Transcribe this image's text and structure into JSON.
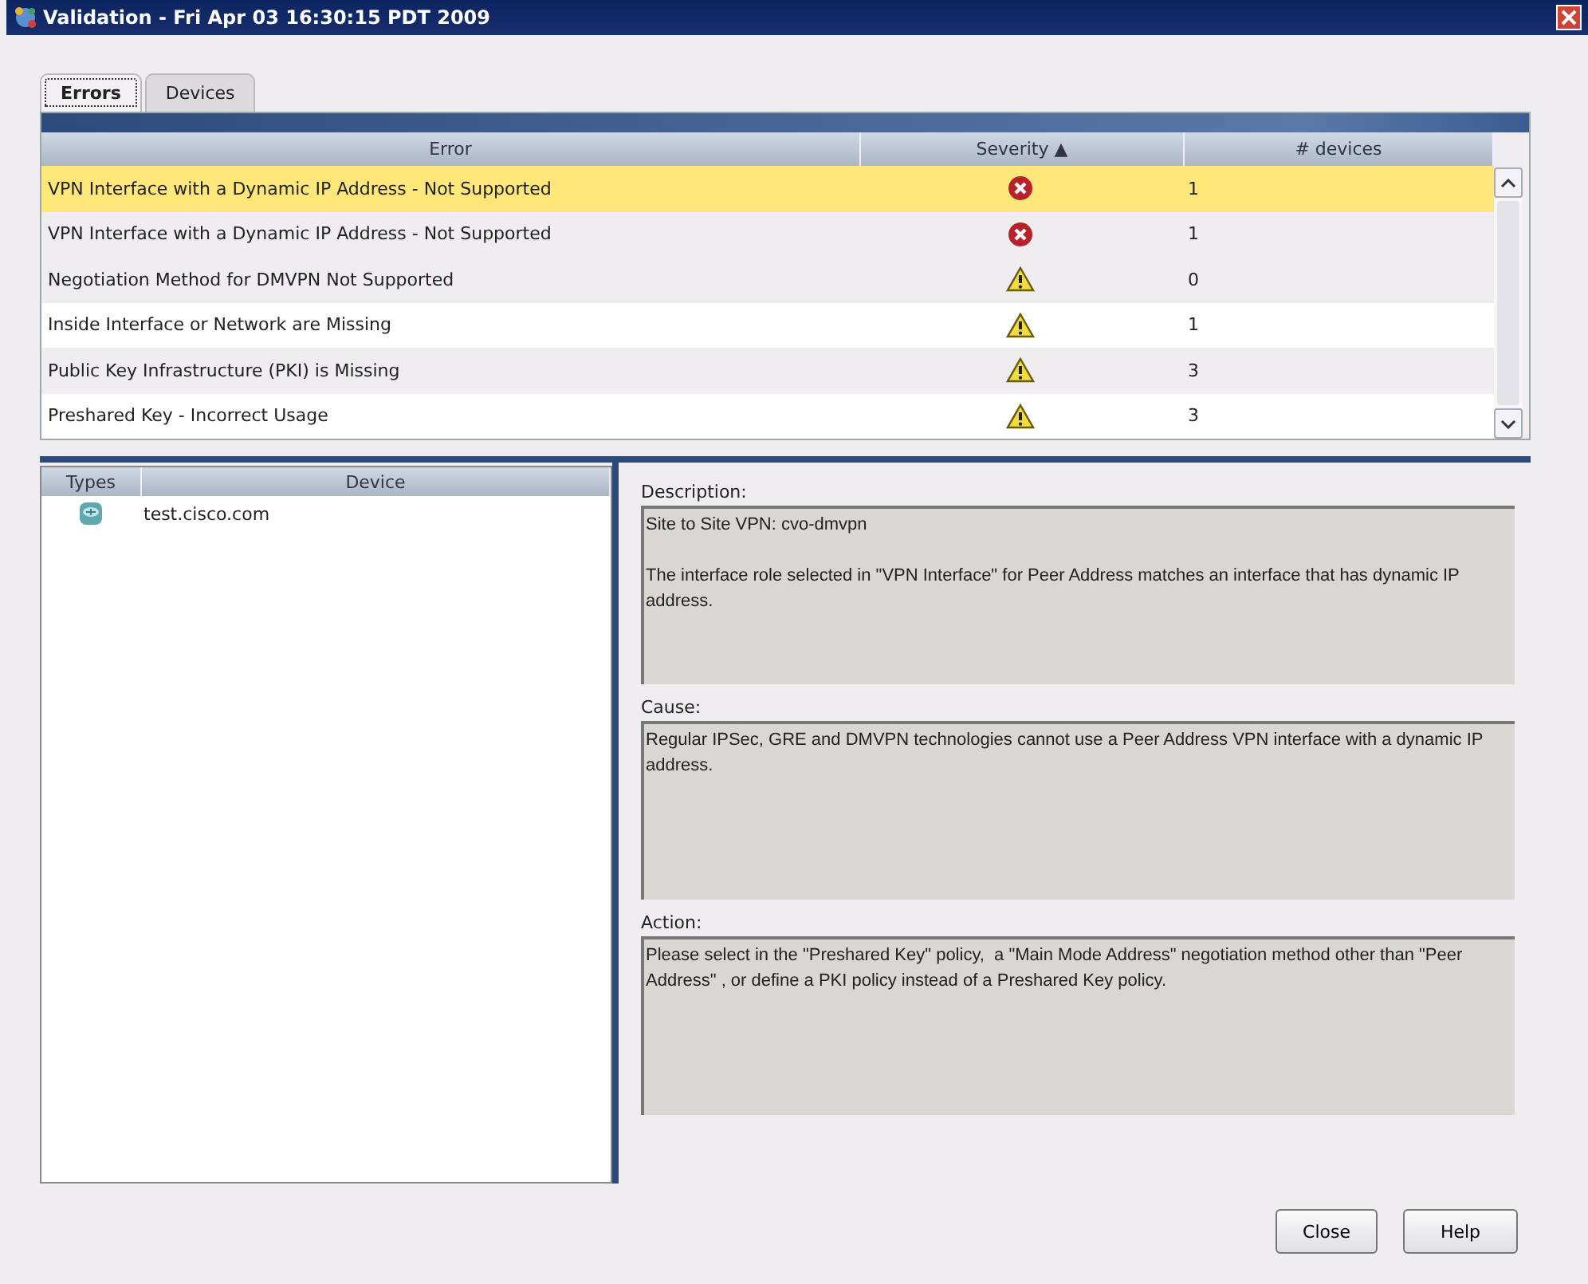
{
  "window": {
    "title": "Validation - Fri Apr 03 16:30:15 PDT 2009"
  },
  "tabs": [
    {
      "label": "Errors",
      "selected": true
    },
    {
      "label": "Devices",
      "selected": false
    }
  ],
  "errors_table": {
    "columns": [
      "Error",
      "Severity ▲",
      "# devices"
    ],
    "rows": [
      {
        "error": "VPN Interface with a Dynamic IP Address - Not Supported",
        "kind": "error",
        "devices": "1",
        "selected": true
      },
      {
        "error": "VPN Interface with a Dynamic IP Address - Not Supported",
        "kind": "error",
        "devices": "1",
        "selected": false
      },
      {
        "error": "Negotiation Method for DMVPN Not Supported",
        "kind": "warning",
        "devices": "0",
        "selected": false
      },
      {
        "error": "Inside Interface or Network are Missing",
        "kind": "warning",
        "devices": "1",
        "selected": false
      },
      {
        "error": "Public Key Infrastructure (PKI) is Missing",
        "kind": "warning",
        "devices": "3",
        "selected": false
      },
      {
        "error": "Preshared Key - Incorrect Usage",
        "kind": "warning",
        "devices": "3",
        "selected": false
      }
    ]
  },
  "device_table": {
    "columns": [
      "Types",
      "Device"
    ],
    "rows": [
      {
        "device": "test.cisco.com"
      }
    ]
  },
  "details": [
    {
      "label": "Description:",
      "text": "Site to Site VPN: cvo-dmvpn\n\nThe interface role selected in \"VPN Interface\" for Peer Address matches an interface that has dynamic IP address."
    },
    {
      "label": "Cause:",
      "text": "Regular IPSec, GRE and DMVPN technologies cannot use a Peer Address VPN interface with a dynamic IP address."
    },
    {
      "label": "Action:",
      "text": "Please select in the \"Preshared Key\" policy,  a \"Main Mode Address\" negotiation method other than \"Peer Address\" , or define a PKI policy instead of a Preshared Key policy."
    }
  ],
  "buttons": [
    "Close",
    "Help"
  ]
}
